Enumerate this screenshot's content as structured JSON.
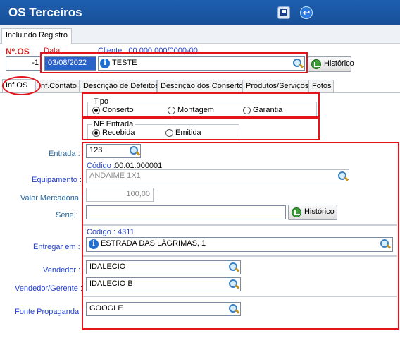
{
  "window": {
    "title": "OS Terceiros"
  },
  "toolbar": {
    "save_icon": "save-disk-icon",
    "exit_icon": "exit-icon",
    "exit_glyph": "↩"
  },
  "header_tab": "Incluindo Registro",
  "top": {
    "nro_label": "Nº.OS",
    "data_label": "Data",
    "cliente_label": "Cliente : 00.000.000/0000-00",
    "nro_value": "-1",
    "date_value": "03/08/2022",
    "cliente_value": "TESTE",
    "historico_label": "Histórico"
  },
  "tabs": [
    "Inf.OS",
    "Inf.Contato",
    "Descrição de Defeitos",
    "Descrição dos Consertos",
    "Produtos/Serviços",
    "Fotos"
  ],
  "tipo": {
    "title": "Tipo",
    "options": [
      "Conserto",
      "Montagem",
      "Garantia"
    ],
    "selected": "Conserto"
  },
  "nf_entrada": {
    "title": "NF Entrada",
    "options": [
      "Recebida",
      "Emitida"
    ],
    "selected": "Recebida"
  },
  "form": {
    "entrada_label": "Entrada :",
    "entrada_value": "123",
    "codigo_label": "Código :",
    "codigo_value": "00.01.000001",
    "equipamento_label": "Equipamento :",
    "equipamento_value": "ANDAIME 1X1",
    "valor_label": "Valor Mercadoria :",
    "valor_value": "100,00",
    "serie_label": "Série :",
    "serie_value": "",
    "serie_historico": "Histórico",
    "entregar_codigo_label": "Código : 4311",
    "entregar_label": "Entregar em :",
    "entregar_value": "ESTRADA DAS LÁGRIMAS, 1",
    "vendedor_label": "Vendedor :",
    "vendedor_value": "IDALECIO",
    "vendedor_gerente_label": "Vendedor/Gerente :",
    "vendedor_gerente_value": "IDALECIO B",
    "fonte_label": "Fonte Propaganda :",
    "fonte_value": "GOOGLE"
  },
  "colors": {
    "title_bar": "#1e5fb0",
    "annotation": "#e4141b",
    "label_blue": "#1f3fd0",
    "label_red": "#d0201f"
  }
}
